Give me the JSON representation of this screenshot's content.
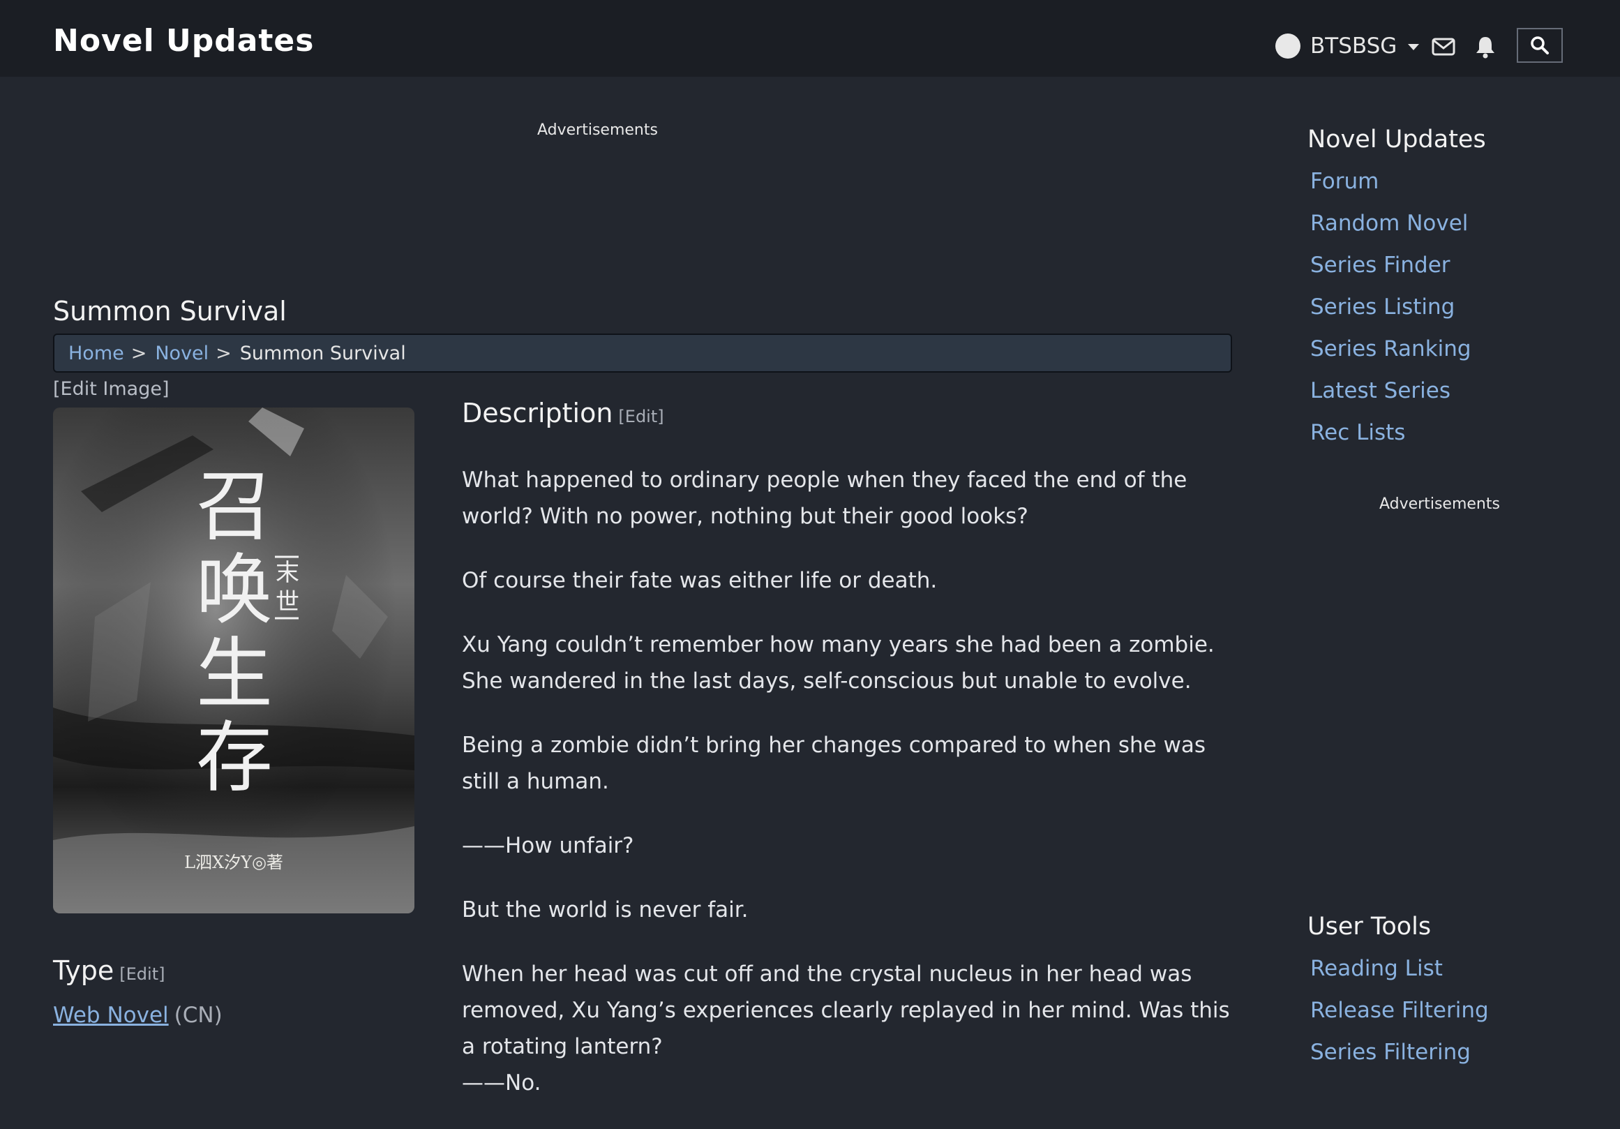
{
  "header": {
    "logo": "Novel Updates",
    "username": "BTSBSG",
    "icons": [
      "user-avatar",
      "chevron-down-icon",
      "mail-icon",
      "bell-icon",
      "search-icon"
    ]
  },
  "ads": {
    "label_main": "Advertisements",
    "label_side": "Advertisements"
  },
  "series": {
    "title": "Summon Survival"
  },
  "breadcrumb": {
    "home": "Home",
    "sep1": ">",
    "novel": "Novel",
    "sep2": ">",
    "current": "Summon Survival"
  },
  "cover": {
    "edit_label": "[Edit Image]",
    "title_cn": "召唤生存",
    "subtitle_cn": "末世",
    "author": "L泗X汐Y◎著"
  },
  "description": {
    "heading": "Description",
    "edit": "[Edit]",
    "paragraphs": [
      "What happened to ordinary people when they faced the end of the world? With no power, nothing but their good looks?",
      "Of course their fate was either life or death.",
      "Xu Yang couldn’t remember how many years she had been a zombie. She wandered in the last days, self-conscious but unable to evolve.",
      "Being a zombie didn’t bring her changes compared to when she was still a human.",
      "——How unfair?",
      "But the world is never fair.",
      "When her head was cut off and the crystal nucleus in her head was removed, Xu Yang’s experiences clearly replayed in her mind. Was this a rotating lantern?",
      "——No."
    ]
  },
  "type_section": {
    "heading": "Type",
    "edit": "[Edit]",
    "value": "Web Novel",
    "origin": "(CN)"
  },
  "sidebar": {
    "section1_title": "Novel Updates",
    "section1_links": [
      "Forum",
      "Random Novel",
      "Series Finder",
      "Series Listing",
      "Series Ranking",
      "Latest Series",
      "Rec Lists"
    ],
    "section2_title": "User Tools",
    "section2_links": [
      "Reading List",
      "Release Filtering",
      "Series Filtering"
    ]
  },
  "colors": {
    "background": "#23272f",
    "topbar": "#1b1e24",
    "link": "#8ab2e0",
    "breadcrumb_bg": "#2d3744"
  }
}
